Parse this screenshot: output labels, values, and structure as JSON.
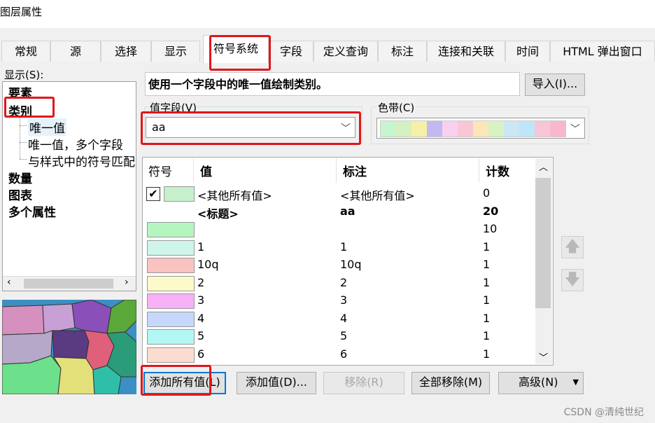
{
  "window": {
    "title": "图层属性"
  },
  "tabs": [
    "常规",
    "源",
    "选择",
    "显示",
    "符号系统",
    "字段",
    "定义查询",
    "标注",
    "连接和关联",
    "时间",
    "HTML 弹出窗口"
  ],
  "show_label": "显示(S):",
  "tree": {
    "items": [
      "要素",
      "类别",
      "唯一值",
      "唯一值，多个字段",
      "与样式中的符号匹配",
      "数量",
      "图表",
      "多个属性"
    ]
  },
  "description": "使用一个字段中的唯一值绘制类别。",
  "import_button": "导入(I)...",
  "value_field": {
    "label": "值字段(V)",
    "value": "aa"
  },
  "color_ramp": {
    "label": "色带(C)",
    "colors": [
      "#c6f5d0",
      "#d6f0c0",
      "#f4f0a8",
      "#c3b8f0",
      "#f8d0f0",
      "#f9c6d4",
      "#fce6b8",
      "#d8f3c2",
      "#cbe7f6",
      "#bfe6f8",
      "#f6c6d6",
      "#f8b8cc"
    ]
  },
  "table": {
    "headers": {
      "symbol": "符号",
      "value": "值",
      "label": "标注",
      "count": "计数"
    },
    "rows": [
      {
        "color": "#c6f0cc",
        "checkbox": true,
        "value": "<其他所有值>",
        "label": "<其他所有值>",
        "count": "0",
        "bold": false
      },
      {
        "color": "",
        "checkbox": false,
        "value": "<标题>",
        "label": "aa",
        "count": "20",
        "bold": true
      },
      {
        "color": "#b5f5c0",
        "checkbox": false,
        "value": "",
        "label": "",
        "count": "10",
        "bold": false
      },
      {
        "color": "#cff5ea",
        "checkbox": false,
        "value": "1",
        "label": "1",
        "count": "1",
        "bold": false
      },
      {
        "color": "#fbc3c0",
        "checkbox": false,
        "value": "10q",
        "label": "10q",
        "count": "1",
        "bold": false
      },
      {
        "color": "#fbfac8",
        "checkbox": false,
        "value": "2",
        "label": "2",
        "count": "1",
        "bold": false
      },
      {
        "color": "#f8b0f6",
        "checkbox": false,
        "value": "3",
        "label": "3",
        "count": "1",
        "bold": false
      },
      {
        "color": "#c5d8fb",
        "checkbox": false,
        "value": "4",
        "label": "4",
        "count": "1",
        "bold": false
      },
      {
        "color": "#b3f7f4",
        "checkbox": false,
        "value": "5",
        "label": "5",
        "count": "1",
        "bold": false
      },
      {
        "color": "#fbdcd0",
        "checkbox": false,
        "value": "6",
        "label": "6",
        "count": "1",
        "bold": false
      }
    ]
  },
  "buttons": {
    "add_all": "添加所有值(L)",
    "add_value": "添加值(D)...",
    "remove": "移除(R)",
    "remove_all": "全部移除(M)",
    "advanced": "高级(N)"
  },
  "watermark": "CSDN @清纯世纪",
  "highlight_color": "#e0161b"
}
